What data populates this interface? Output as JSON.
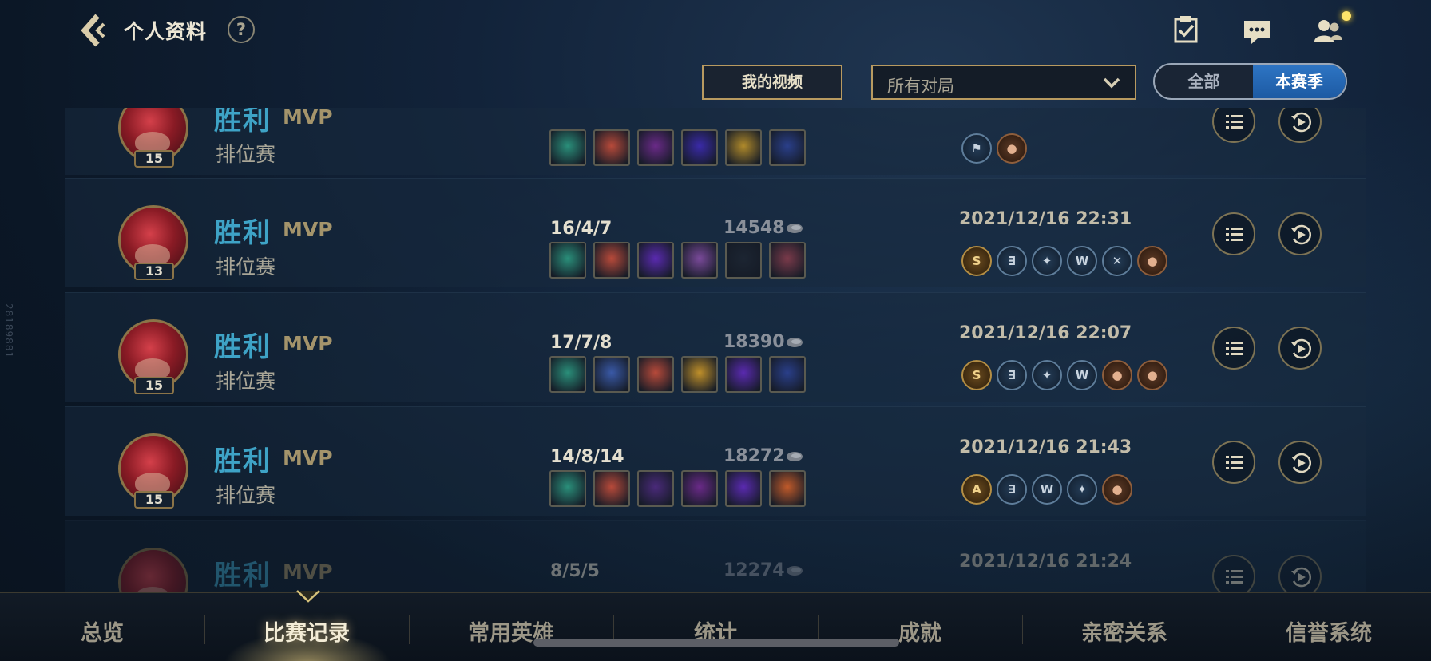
{
  "header": {
    "title": "个人资料",
    "help_label": "?"
  },
  "filters": {
    "video_button": "我的视频",
    "match_filter": "所有对局",
    "season_toggle": [
      "全部",
      "本赛季"
    ],
    "season_selected": "本赛季"
  },
  "side_text": "28189881",
  "matches": [
    {
      "level": "15",
      "result": "胜利",
      "mvp": "MVP",
      "mode": "排位赛",
      "kda": "",
      "gold": "",
      "time": "",
      "items": [
        "#2a8f7a",
        "#b84a3a",
        "#6a2a88",
        "#3a2aa8",
        "#b08a2a",
        "#2a3f8a"
      ],
      "badges": [
        {
          "t": "⚑",
          "k": "blue"
        },
        {
          "t": "●",
          "k": "bronze"
        }
      ]
    },
    {
      "level": "13",
      "result": "胜利",
      "mvp": "MVP",
      "mode": "排位赛",
      "kda": "16/4/7",
      "gold": "14548",
      "time": "2021/12/16 22:31",
      "items": [
        "#2a8f7a",
        "#b84a3a",
        "#5a2ab0",
        "#7a4a9a",
        "#1c2532",
        "#7a3a4a"
      ],
      "badges": [
        {
          "t": "S",
          "k": "gold"
        },
        {
          "t": "∃",
          "k": "blue"
        },
        {
          "t": "✦",
          "k": "blue"
        },
        {
          "t": "W",
          "k": "blue"
        },
        {
          "t": "✕",
          "k": "blue"
        },
        {
          "t": "●",
          "k": "bronze"
        }
      ]
    },
    {
      "level": "15",
      "result": "胜利",
      "mvp": "MVP",
      "mode": "排位赛",
      "kda": "17/7/8",
      "gold": "18390",
      "time": "2021/12/16 22:07",
      "items": [
        "#2a8f7a",
        "#3a5aa8",
        "#b84a3a",
        "#c0902a",
        "#5a2ab0",
        "#2a3f8a"
      ],
      "badges": [
        {
          "t": "S",
          "k": "gold"
        },
        {
          "t": "∃",
          "k": "blue"
        },
        {
          "t": "✦",
          "k": "blue"
        },
        {
          "t": "W",
          "k": "blue"
        },
        {
          "t": "●",
          "k": "bronze"
        },
        {
          "t": "●",
          "k": "bronze"
        }
      ]
    },
    {
      "level": "15",
      "result": "胜利",
      "mvp": "MVP",
      "mode": "排位赛",
      "kda": "14/8/14",
      "gold": "18272",
      "time": "2021/12/16 21:43",
      "items": [
        "#2a8f7a",
        "#b84a3a",
        "#4a2a7a",
        "#6a2a88",
        "#5a2ab0",
        "#c05a2a"
      ],
      "badges": [
        {
          "t": "A",
          "k": "gold"
        },
        {
          "t": "∃",
          "k": "blue"
        },
        {
          "t": "W",
          "k": "blue"
        },
        {
          "t": "✦",
          "k": "blue"
        },
        {
          "t": "●",
          "k": "bronze"
        }
      ]
    },
    {
      "level": "",
      "result": "胜利",
      "mvp": "MVP",
      "mode": "",
      "kda": "8/5/5",
      "gold": "12274",
      "time": "2021/12/16 21:24",
      "items": [],
      "badges": []
    }
  ],
  "nav": {
    "tabs": [
      "总览",
      "比赛记录",
      "常用英雄",
      "统计",
      "成就",
      "亲密关系",
      "信誉系统"
    ],
    "active_index": 1
  },
  "colors": {
    "accent_gold": "#b89a60",
    "win_blue": "#3ea3c6",
    "season_active": "#2e75c4"
  }
}
